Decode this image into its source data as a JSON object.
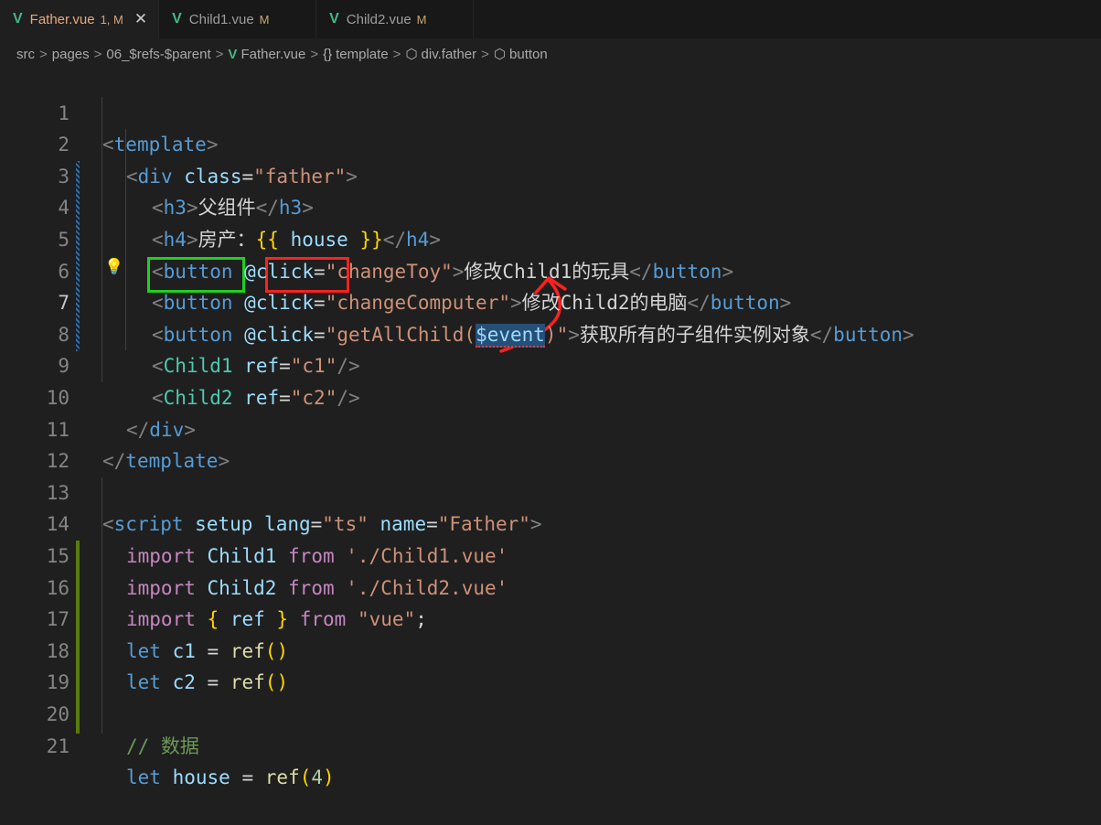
{
  "tabs": [
    {
      "name": "Father.vue",
      "status": "1, M",
      "active": true
    },
    {
      "name": "Child1.vue",
      "status": "M",
      "active": false
    },
    {
      "name": "Child2.vue",
      "status": "M",
      "active": false
    }
  ],
  "breadcrumb": {
    "src": "src",
    "pages": "pages",
    "folder": "06_$refs-$parent",
    "file": "Father.vue",
    "template": "template",
    "div": "div.father",
    "button": "button"
  },
  "line_numbers": [
    "1",
    "2",
    "3",
    "4",
    "5",
    "6",
    "7",
    "8",
    "9",
    "10",
    "11",
    "12",
    "13",
    "14",
    "15",
    "16",
    "17",
    "18",
    "19",
    "20",
    "21"
  ],
  "code": {
    "template_tag": "template",
    "div_tag": "div",
    "class_attr": "class",
    "class_value": "\"father\"",
    "h3_tag": "h3",
    "h3_text": "父组件",
    "h4_tag": "h4",
    "h4_text": "房产：",
    "house_var": "house",
    "button_tag": "button",
    "click_attr": "@click",
    "change_toy": "\"changeToy\"",
    "change_toy_text": "修改Child1的玩具",
    "change_computer": "\"changeComputer\"",
    "change_computer_text": "修改Child2的电脑",
    "get_all_fn": "\"getAllChild(",
    "event_arg": "$event",
    "get_all_close": ")\"",
    "get_all_text": "获取所有的子组件实例对象",
    "child1_tag": "Child1",
    "child2_tag": "Child2",
    "ref_attr": "ref",
    "c1_str": "\"c1\"",
    "c2_str": "\"c2\"",
    "script_tag": "script",
    "setup_attr": "setup",
    "lang_attr": "lang",
    "lang_value": "\"ts\"",
    "name_attr": "name",
    "name_value": "\"Father\"",
    "import_kw": "import",
    "from_kw": "from",
    "child1_path": "'./Child1.vue'",
    "child2_path": "'./Child2.vue'",
    "ref_fn": "ref",
    "vue_path": "\"vue\"",
    "let_kw": "let",
    "c1_var": "c1",
    "c2_var": "c2",
    "comment": "// 数据",
    "house_decl": "house",
    "four": "4"
  },
  "colors": {
    "annotation_green": "#1fd11f",
    "annotation_red": "#ff2020",
    "vue_green": "#41b883"
  }
}
